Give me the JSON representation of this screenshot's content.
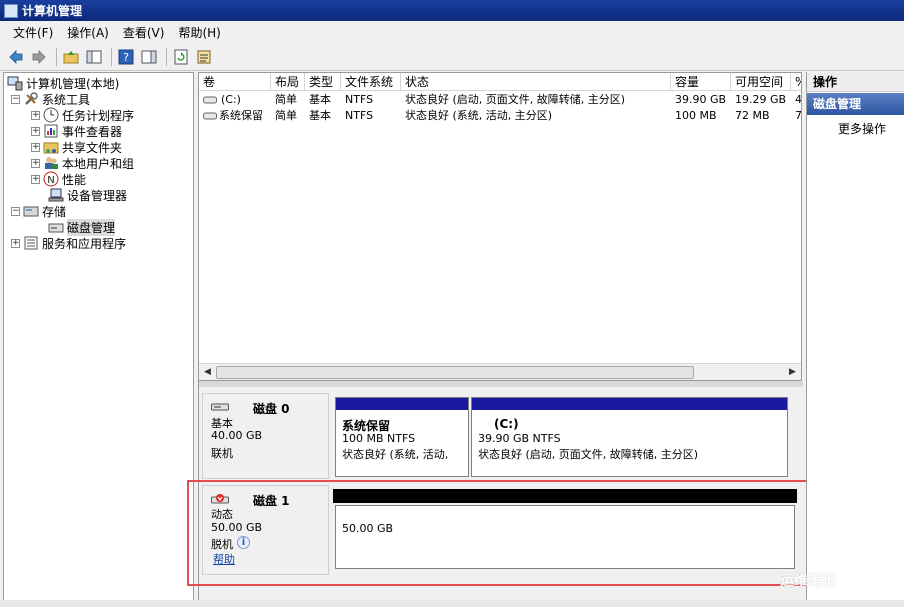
{
  "window": {
    "title": "计算机管理"
  },
  "menu": [
    "文件(F)",
    "操作(A)",
    "查看(V)",
    "帮助(H)"
  ],
  "tree": {
    "root": "计算机管理(本地)",
    "system_tools": "系统工具",
    "task_scheduler": "任务计划程序",
    "event_viewer": "事件查看器",
    "shared_folders": "共享文件夹",
    "local_users": "本地用户和组",
    "performance": "性能",
    "device_manager": "设备管理器",
    "storage": "存储",
    "disk_management": "磁盘管理",
    "services_apps": "服务和应用程序",
    "expander_plus": "+",
    "expander_minus": "−"
  },
  "volumes": {
    "headers": [
      "卷",
      "布局",
      "类型",
      "文件系统",
      "状态",
      "容量",
      "可用空间",
      "%"
    ],
    "rows": [
      {
        "vol": "(C:)",
        "layout": "简单",
        "type": "基本",
        "fs": "NTFS",
        "status": "状态良好 (启动, 页面文件, 故障转储, 主分区)",
        "capacity": "39.90 GB",
        "free": "19.29 GB",
        "pct": "4"
      },
      {
        "vol": "系统保留",
        "layout": "简单",
        "type": "基本",
        "fs": "NTFS",
        "status": "状态良好 (系统, 活动, 主分区)",
        "capacity": "100 MB",
        "free": "72 MB",
        "pct": "7"
      }
    ]
  },
  "scroll": {
    "left": "◀",
    "right": "▶"
  },
  "disk0": {
    "name": "磁盘 0",
    "type": "基本",
    "size": "40.00 GB",
    "state": "联机",
    "partitions": [
      {
        "name": "系统保留",
        "size": "100 MB NTFS",
        "status": "状态良好 (系统, 活动,"
      },
      {
        "name": "(C:)",
        "size": "39.90 GB NTFS",
        "status": "状态良好 (启动, 页面文件, 故障转储, 主分区)"
      }
    ]
  },
  "disk1": {
    "name": "磁盘 1",
    "type": "动态",
    "size": "50.00 GB",
    "state": "脱机",
    "info_glyph": "i",
    "help": "帮助",
    "partition_size": "50.00 GB"
  },
  "actions": {
    "header": "操作",
    "section": "磁盘管理",
    "more": "更多操作"
  },
  "watermark": "运维笔记",
  "colors": {
    "primary_bar": "#1a1aa0",
    "unallocated_bar": "#000000",
    "highlight": "#e24d4d",
    "title": "#1a3f9e"
  }
}
